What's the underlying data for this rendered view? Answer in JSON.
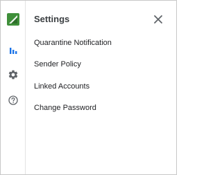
{
  "panel": {
    "title": "Settings",
    "close_icon": "close-icon"
  },
  "rail": {
    "logo_icon": "brand-logo-icon",
    "items": [
      {
        "icon": "bar-chart-icon",
        "active": true
      },
      {
        "icon": "gear-icon",
        "active": false
      },
      {
        "icon": "help-circle-icon",
        "active": false
      }
    ]
  },
  "menu": {
    "items": [
      {
        "label": "Quarantine Notification"
      },
      {
        "label": "Sender Policy"
      },
      {
        "label": "Linked Accounts"
      },
      {
        "label": "Change Password"
      }
    ]
  },
  "colors": {
    "brand_green": "#3f8f3a",
    "accent_blue": "#1a73e8",
    "icon_gray": "#5f6368",
    "border": "#c8c8c8"
  }
}
